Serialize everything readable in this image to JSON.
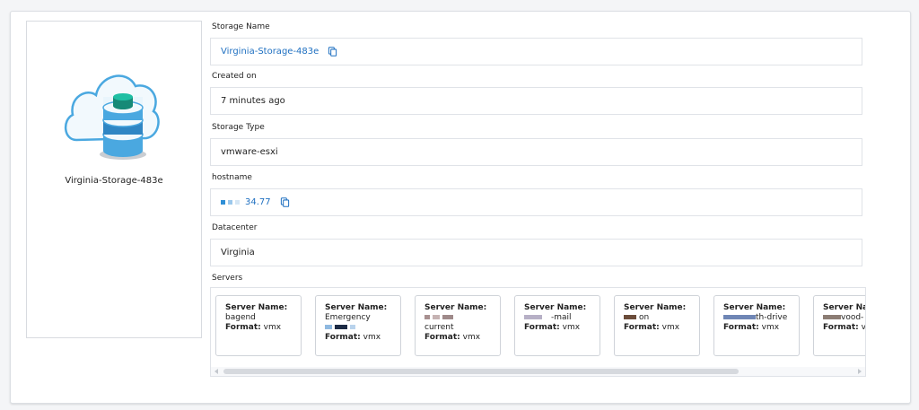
{
  "storage": {
    "display_name": "Virginia-Storage-483e",
    "fields": {
      "storage_name_label": "Storage Name",
      "storage_name_value": "Virginia-Storage-483e",
      "created_on_label": "Created on",
      "created_on_value": "7 minutes ago",
      "storage_type_label": "Storage Type",
      "storage_type_value": "vmware-esxi",
      "hostname_label": "hostname",
      "hostname_value": "34.77",
      "datacenter_label": "Datacenter",
      "datacenter_value": "Virginia",
      "servers_label": "Servers"
    }
  },
  "servers": [
    {
      "name_label": "Server Name:",
      "name": "bagend",
      "format_label": "Format:",
      "format": "vmx"
    },
    {
      "name_label": "Server Name:",
      "name": "Emergency",
      "format_label": "Format:",
      "format": "vmx"
    },
    {
      "name_label": "Server Name:",
      "name": "current",
      "format_label": "Format:",
      "format": "vmx"
    },
    {
      "name_label": "Server Name:",
      "name": "-mail",
      "format_label": "Format:",
      "format": "vmx"
    },
    {
      "name_label": "Server Name:",
      "name": "on",
      "format_label": "Format:",
      "format": "vmx"
    },
    {
      "name_label": "Server Name:",
      "name": "th-drive",
      "format_label": "Format:",
      "format": "vmx"
    },
    {
      "name_label": "Server Nam",
      "name": "vood-",
      "format_label": "Format:",
      "format": "vm"
    }
  ],
  "icons": {
    "storage_illustration": "cloud-database-icon",
    "copy": "copy-icon"
  },
  "colors": {
    "link": "#1f70c1",
    "illustration_blue": "#4aa8e0",
    "illustration_teal": "#1aa38c"
  }
}
